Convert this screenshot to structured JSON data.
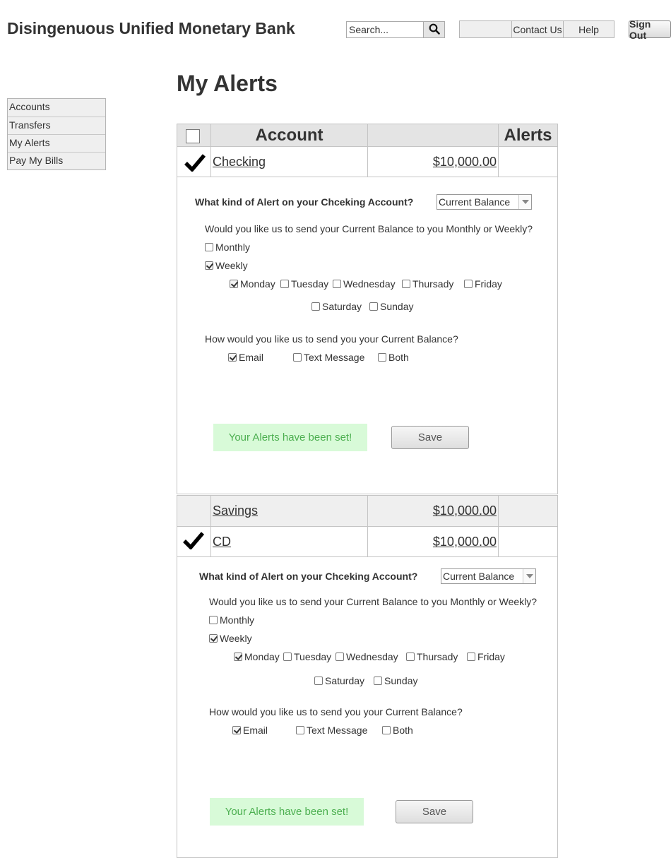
{
  "header": {
    "brand": "Disingenuous Unified Monetary Bank",
    "search": {
      "placeholder": "Search...",
      "icon": "magnifier-icon"
    },
    "nav": {
      "blank": "",
      "contact": "Contact Us",
      "help": "Help"
    },
    "sign_out": "Sign Out"
  },
  "sidebar": {
    "items": [
      {
        "label": "Accounts"
      },
      {
        "label": "Transfers"
      },
      {
        "label": "My Alerts"
      },
      {
        "label": "Pay My Bills"
      }
    ]
  },
  "page": {
    "title": "My Alerts"
  },
  "table": {
    "headers": {
      "account": "Account",
      "amount": "",
      "alerts": "Alerts"
    },
    "rows": [
      {
        "name": "Checking",
        "amount": "$10,000.00",
        "selected": true
      },
      {
        "name": "Savings",
        "amount": "$10,000.00",
        "selected": false
      },
      {
        "name": "CD",
        "amount": "$10,000.00",
        "selected": true
      }
    ]
  },
  "panels": [
    {
      "question": "What kind of Alert on your Chceking Account?",
      "alert_type": "Current Balance",
      "frequency_question": "Would you like us to send your Current Balance to you Monthly or Weekly?",
      "frequency": {
        "monthly": {
          "label": "Monthly",
          "checked": false
        },
        "weekly": {
          "label": "Weekly",
          "checked": true
        }
      },
      "days": {
        "monday": {
          "label": "Monday",
          "checked": true
        },
        "tuesday": {
          "label": "Tuesday",
          "checked": false
        },
        "wednesday": {
          "label": "Wednesday",
          "checked": false
        },
        "thursday": {
          "label": "Thursady",
          "checked": false
        },
        "friday": {
          "label": "Friday",
          "checked": false
        },
        "saturday": {
          "label": "Saturday",
          "checked": false
        },
        "sunday": {
          "label": "Sunday",
          "checked": false
        }
      },
      "method_question": "How would you like us to send you your Current Balance?",
      "methods": {
        "email": {
          "label": "Email",
          "checked": true
        },
        "text": {
          "label": "Text Message",
          "checked": false
        },
        "both": {
          "label": "Both",
          "checked": false
        }
      },
      "status": "Your Alerts have been set!",
      "save_label": "Save"
    },
    {
      "question": "What kind of Alert on your Chceking Account?",
      "alert_type": "Current Balance",
      "frequency_question": "Would you like us to send your Current Balance to you Monthly or Weekly?",
      "frequency": {
        "monthly": {
          "label": "Monthly",
          "checked": false
        },
        "weekly": {
          "label": "Weekly",
          "checked": true
        }
      },
      "days": {
        "monday": {
          "label": "Monday",
          "checked": true
        },
        "tuesday": {
          "label": "Tuesday",
          "checked": false
        },
        "wednesday": {
          "label": "Wednesday",
          "checked": false
        },
        "thursday": {
          "label": "Thursady",
          "checked": false
        },
        "friday": {
          "label": "Friday",
          "checked": false
        },
        "saturday": {
          "label": "Saturday",
          "checked": false
        },
        "sunday": {
          "label": "Sunday",
          "checked": false
        }
      },
      "method_question": "How would you like us to send you your Current Balance?",
      "methods": {
        "email": {
          "label": "Email",
          "checked": true
        },
        "text": {
          "label": "Text Message",
          "checked": false
        },
        "both": {
          "label": "Both",
          "checked": false
        }
      },
      "status": "Your Alerts have been set!",
      "save_label": "Save"
    }
  ]
}
